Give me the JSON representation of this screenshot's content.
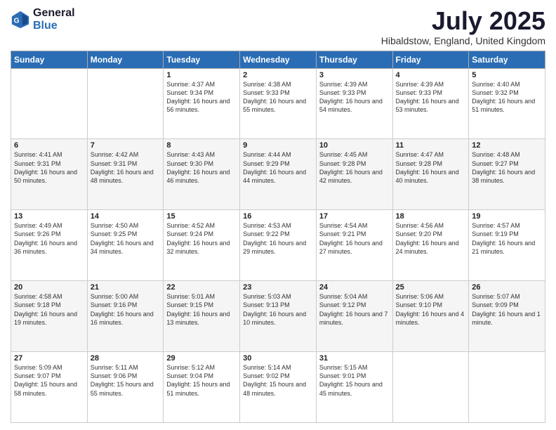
{
  "logo": {
    "general": "General",
    "blue": "Blue"
  },
  "title": "July 2025",
  "location": "Hibaldstow, England, United Kingdom",
  "weekdays": [
    "Sunday",
    "Monday",
    "Tuesday",
    "Wednesday",
    "Thursday",
    "Friday",
    "Saturday"
  ],
  "weeks": [
    [
      {
        "day": "",
        "sunrise": "",
        "sunset": "",
        "daylight": ""
      },
      {
        "day": "",
        "sunrise": "",
        "sunset": "",
        "daylight": ""
      },
      {
        "day": "1",
        "sunrise": "Sunrise: 4:37 AM",
        "sunset": "Sunset: 9:34 PM",
        "daylight": "Daylight: 16 hours and 56 minutes."
      },
      {
        "day": "2",
        "sunrise": "Sunrise: 4:38 AM",
        "sunset": "Sunset: 9:33 PM",
        "daylight": "Daylight: 16 hours and 55 minutes."
      },
      {
        "day": "3",
        "sunrise": "Sunrise: 4:39 AM",
        "sunset": "Sunset: 9:33 PM",
        "daylight": "Daylight: 16 hours and 54 minutes."
      },
      {
        "day": "4",
        "sunrise": "Sunrise: 4:39 AM",
        "sunset": "Sunset: 9:33 PM",
        "daylight": "Daylight: 16 hours and 53 minutes."
      },
      {
        "day": "5",
        "sunrise": "Sunrise: 4:40 AM",
        "sunset": "Sunset: 9:32 PM",
        "daylight": "Daylight: 16 hours and 51 minutes."
      }
    ],
    [
      {
        "day": "6",
        "sunrise": "Sunrise: 4:41 AM",
        "sunset": "Sunset: 9:31 PM",
        "daylight": "Daylight: 16 hours and 50 minutes."
      },
      {
        "day": "7",
        "sunrise": "Sunrise: 4:42 AM",
        "sunset": "Sunset: 9:31 PM",
        "daylight": "Daylight: 16 hours and 48 minutes."
      },
      {
        "day": "8",
        "sunrise": "Sunrise: 4:43 AM",
        "sunset": "Sunset: 9:30 PM",
        "daylight": "Daylight: 16 hours and 46 minutes."
      },
      {
        "day": "9",
        "sunrise": "Sunrise: 4:44 AM",
        "sunset": "Sunset: 9:29 PM",
        "daylight": "Daylight: 16 hours and 44 minutes."
      },
      {
        "day": "10",
        "sunrise": "Sunrise: 4:45 AM",
        "sunset": "Sunset: 9:28 PM",
        "daylight": "Daylight: 16 hours and 42 minutes."
      },
      {
        "day": "11",
        "sunrise": "Sunrise: 4:47 AM",
        "sunset": "Sunset: 9:28 PM",
        "daylight": "Daylight: 16 hours and 40 minutes."
      },
      {
        "day": "12",
        "sunrise": "Sunrise: 4:48 AM",
        "sunset": "Sunset: 9:27 PM",
        "daylight": "Daylight: 16 hours and 38 minutes."
      }
    ],
    [
      {
        "day": "13",
        "sunrise": "Sunrise: 4:49 AM",
        "sunset": "Sunset: 9:26 PM",
        "daylight": "Daylight: 16 hours and 36 minutes."
      },
      {
        "day": "14",
        "sunrise": "Sunrise: 4:50 AM",
        "sunset": "Sunset: 9:25 PM",
        "daylight": "Daylight: 16 hours and 34 minutes."
      },
      {
        "day": "15",
        "sunrise": "Sunrise: 4:52 AM",
        "sunset": "Sunset: 9:24 PM",
        "daylight": "Daylight: 16 hours and 32 minutes."
      },
      {
        "day": "16",
        "sunrise": "Sunrise: 4:53 AM",
        "sunset": "Sunset: 9:22 PM",
        "daylight": "Daylight: 16 hours and 29 minutes."
      },
      {
        "day": "17",
        "sunrise": "Sunrise: 4:54 AM",
        "sunset": "Sunset: 9:21 PM",
        "daylight": "Daylight: 16 hours and 27 minutes."
      },
      {
        "day": "18",
        "sunrise": "Sunrise: 4:56 AM",
        "sunset": "Sunset: 9:20 PM",
        "daylight": "Daylight: 16 hours and 24 minutes."
      },
      {
        "day": "19",
        "sunrise": "Sunrise: 4:57 AM",
        "sunset": "Sunset: 9:19 PM",
        "daylight": "Daylight: 16 hours and 21 minutes."
      }
    ],
    [
      {
        "day": "20",
        "sunrise": "Sunrise: 4:58 AM",
        "sunset": "Sunset: 9:18 PM",
        "daylight": "Daylight: 16 hours and 19 minutes."
      },
      {
        "day": "21",
        "sunrise": "Sunrise: 5:00 AM",
        "sunset": "Sunset: 9:16 PM",
        "daylight": "Daylight: 16 hours and 16 minutes."
      },
      {
        "day": "22",
        "sunrise": "Sunrise: 5:01 AM",
        "sunset": "Sunset: 9:15 PM",
        "daylight": "Daylight: 16 hours and 13 minutes."
      },
      {
        "day": "23",
        "sunrise": "Sunrise: 5:03 AM",
        "sunset": "Sunset: 9:13 PM",
        "daylight": "Daylight: 16 hours and 10 minutes."
      },
      {
        "day": "24",
        "sunrise": "Sunrise: 5:04 AM",
        "sunset": "Sunset: 9:12 PM",
        "daylight": "Daylight: 16 hours and 7 minutes."
      },
      {
        "day": "25",
        "sunrise": "Sunrise: 5:06 AM",
        "sunset": "Sunset: 9:10 PM",
        "daylight": "Daylight: 16 hours and 4 minutes."
      },
      {
        "day": "26",
        "sunrise": "Sunrise: 5:07 AM",
        "sunset": "Sunset: 9:09 PM",
        "daylight": "Daylight: 16 hours and 1 minute."
      }
    ],
    [
      {
        "day": "27",
        "sunrise": "Sunrise: 5:09 AM",
        "sunset": "Sunset: 9:07 PM",
        "daylight": "Daylight: 15 hours and 58 minutes."
      },
      {
        "day": "28",
        "sunrise": "Sunrise: 5:11 AM",
        "sunset": "Sunset: 9:06 PM",
        "daylight": "Daylight: 15 hours and 55 minutes."
      },
      {
        "day": "29",
        "sunrise": "Sunrise: 5:12 AM",
        "sunset": "Sunset: 9:04 PM",
        "daylight": "Daylight: 15 hours and 51 minutes."
      },
      {
        "day": "30",
        "sunrise": "Sunrise: 5:14 AM",
        "sunset": "Sunset: 9:02 PM",
        "daylight": "Daylight: 15 hours and 48 minutes."
      },
      {
        "day": "31",
        "sunrise": "Sunrise: 5:15 AM",
        "sunset": "Sunset: 9:01 PM",
        "daylight": "Daylight: 15 hours and 45 minutes."
      },
      {
        "day": "",
        "sunrise": "",
        "sunset": "",
        "daylight": ""
      },
      {
        "day": "",
        "sunrise": "",
        "sunset": "",
        "daylight": ""
      }
    ]
  ]
}
